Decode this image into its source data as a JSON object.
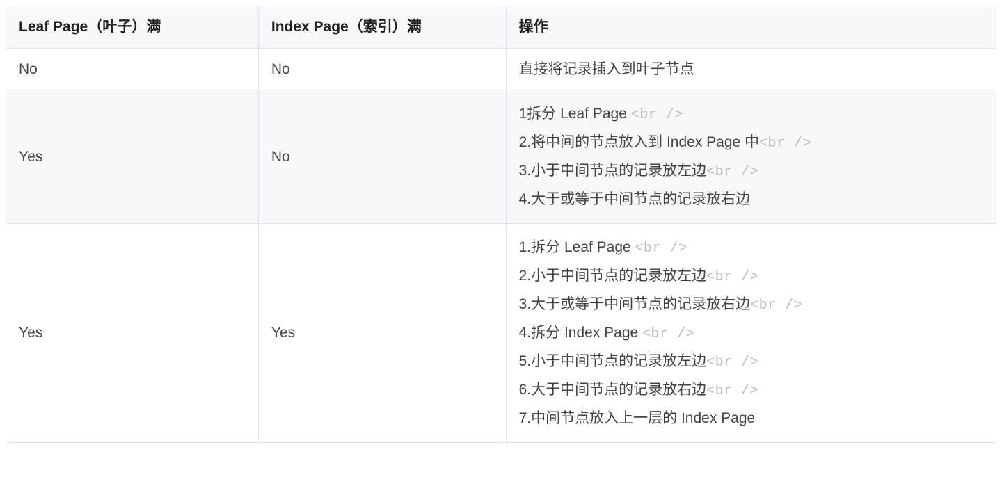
{
  "faded_tag": "<br />",
  "headers": [
    "Leaf Page（叶子）满",
    "Index Page（索引）满",
    "操作"
  ],
  "rows": [
    {
      "leaf": "No",
      "index": "No",
      "ops": [
        {
          "text": "直接将记录插入到叶子节点",
          "br": false
        }
      ]
    },
    {
      "leaf": "Yes",
      "index": "No",
      "ops": [
        {
          "text": "1拆分 Leaf Page ",
          "br": true
        },
        {
          "text": "2.将中间的节点放入到 Index Page 中",
          "br": true
        },
        {
          "text": "3.小于中间节点的记录放左边",
          "br": true
        },
        {
          "text": "4.大于或等于中间节点的记录放右边",
          "br": false
        }
      ]
    },
    {
      "leaf": "Yes",
      "index": "Yes",
      "ops": [
        {
          "text": "1.拆分 Leaf Page ",
          "br": true
        },
        {
          "text": "2.小于中间节点的记录放左边",
          "br": true
        },
        {
          "text": "3.大于或等于中间节点的记录放右边",
          "br": true
        },
        {
          "text": "4.拆分 Index Page ",
          "br": true
        },
        {
          "text": "5.小于中间节点的记录放左边",
          "br": true
        },
        {
          "text": "6.大于中间节点的记录放右边",
          "br": true
        },
        {
          "text": "7.中间节点放入上一层的 Index Page",
          "br": false
        }
      ]
    }
  ]
}
